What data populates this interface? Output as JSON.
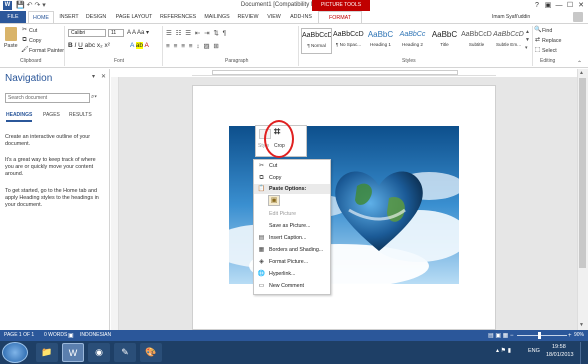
{
  "window": {
    "title": "Document1 [Compatibility Mode] - Word",
    "contextual_group": "PICTURE TOOLS",
    "controls": [
      "?",
      "▣",
      "—",
      "☐",
      "✕"
    ]
  },
  "tabs": [
    "FILE",
    "HOME",
    "INSERT",
    "DESIGN",
    "PAGE LAYOUT",
    "REFERENCES",
    "MAILINGS",
    "REVIEW",
    "VIEW",
    "ADD-INS",
    "FORMAT"
  ],
  "user": "Imam Syafi'uddin",
  "ribbon": {
    "clipboard": {
      "paste": "Paste",
      "cut": "Cut",
      "copy": "Copy",
      "format_painter": "Format Painter",
      "label": "Clipboard"
    },
    "font": {
      "name": "Calibri",
      "size": "11",
      "label": "Font"
    },
    "paragraph": {
      "label": "Paragraph"
    },
    "styles": {
      "label": "Styles",
      "items": [
        {
          "preview": "AaBbCcDc",
          "name": "¶ Normal"
        },
        {
          "preview": "AaBbCcDc",
          "name": "¶ No Spac..."
        },
        {
          "preview": "AaBbC",
          "name": "Heading 1"
        },
        {
          "preview": "AaBbCc",
          "name": "Heading 2"
        },
        {
          "preview": "AaBbC",
          "name": "Title"
        },
        {
          "preview": "AaBbCcD",
          "name": "Subtitle"
        },
        {
          "preview": "AaBbCcD",
          "name": "Subtle Em..."
        }
      ]
    },
    "editing": {
      "find": "Find",
      "replace": "Replace",
      "select": "Select",
      "label": "Editing"
    }
  },
  "navigation": {
    "title": "Navigation",
    "search_placeholder": "Search document",
    "tabs": [
      "HEADINGS",
      "PAGES",
      "RESULTS"
    ],
    "paragraphs": [
      "Create an interactive outline of your document.",
      "It's a great way to keep track of where you are or quickly move your content around.",
      "To get started, go to the Home tab and apply Heading styles to the headings in your document."
    ]
  },
  "mini_toolbar": {
    "style": "Style",
    "crop": "Crop"
  },
  "context_menu": {
    "items": [
      {
        "label": "Cut",
        "icon": "scissors-icon",
        "glyph": "✂",
        "enabled": true
      },
      {
        "label": "Copy",
        "icon": "copy-icon",
        "glyph": "⧉",
        "enabled": true
      },
      {
        "label": "Paste Options:",
        "icon": "paste-icon",
        "glyph": "📋",
        "enabled": true,
        "header": true
      },
      {
        "label": "",
        "icon": "paste-picture-icon",
        "glyph": "▣",
        "enabled": true
      },
      {
        "label": "Edit Picture",
        "icon": "",
        "glyph": "",
        "enabled": false
      },
      {
        "label": "Save as Picture...",
        "icon": "",
        "glyph": "",
        "enabled": true
      },
      {
        "label": "Insert Caption...",
        "icon": "caption-icon",
        "glyph": "▤",
        "enabled": true
      },
      {
        "label": "Borders and Shading...",
        "icon": "borders-icon",
        "glyph": "▦",
        "enabled": true
      },
      {
        "label": "Format Picture...",
        "icon": "format-picture-icon",
        "glyph": "◈",
        "enabled": true
      },
      {
        "label": "Hyperlink...",
        "icon": "hyperlink-icon",
        "glyph": "🌐",
        "enabled": true
      },
      {
        "label": "New Comment",
        "icon": "comment-icon",
        "glyph": "▭",
        "enabled": true
      }
    ]
  },
  "status": {
    "page": "PAGE 1 OF 1",
    "words": "0 WORDS",
    "language": "INDONESIAN",
    "zoom": "90%"
  },
  "taskbar": {
    "language": "ENG",
    "time": "19:58",
    "date": "18/01/2013"
  },
  "colors": {
    "word_blue": "#2b579a",
    "picture_tools_red": "#c00000",
    "highlight_circle": "#e02020"
  }
}
